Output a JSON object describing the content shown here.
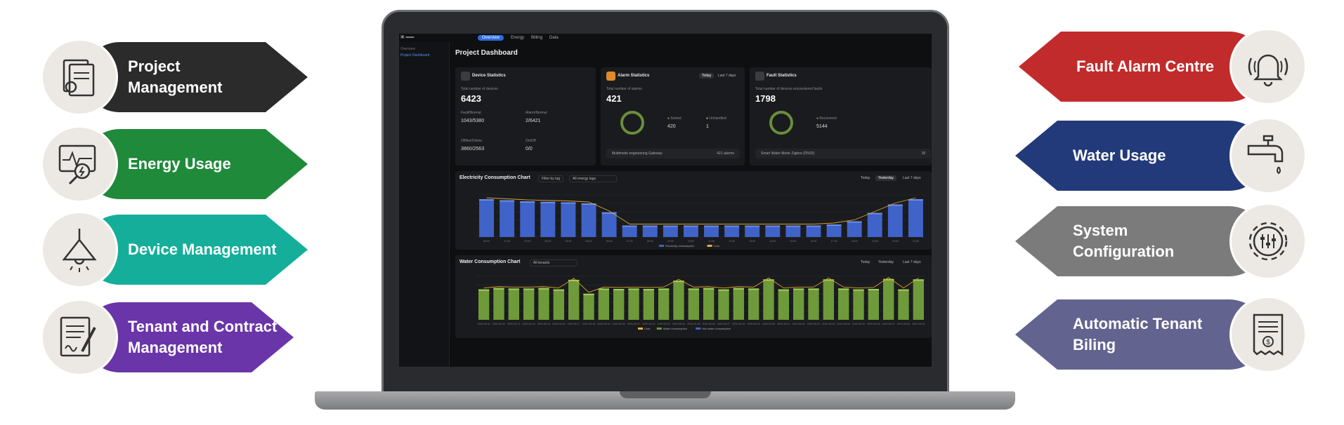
{
  "left_features": [
    {
      "label": "Project\nManagement",
      "icon": "document-icon",
      "color": "#2b2b2b"
    },
    {
      "label": "Energy Usage",
      "icon": "energy-monitor-icon",
      "color": "#1f8a3a"
    },
    {
      "label": "Device Management",
      "icon": "lamp-icon",
      "color": "#15ae9a"
    },
    {
      "label": "Tenant and Contract\nManagement",
      "icon": "contract-icon",
      "color": "#6a35a8"
    }
  ],
  "right_features": [
    {
      "label": "Fault Alarm Centre",
      "icon": "alarm-bell-icon",
      "color": "#c22b2b"
    },
    {
      "label": "Water Usage",
      "icon": "water-tap-icon",
      "color": "#233a7a"
    },
    {
      "label": "System\nConfiguration",
      "icon": "gear-sliders-icon",
      "color": "#7b7b7b"
    },
    {
      "label": "Automatic Tenant\nBiling",
      "icon": "invoice-icon",
      "color": "#63638f"
    }
  ],
  "dashboard": {
    "nav": {
      "tabs": [
        "Overview",
        "Energy",
        "Billing",
        "Data"
      ],
      "active": "Overview"
    },
    "sidebar": {
      "overview": "Overview",
      "project_dashboard": "Project Dashboard"
    },
    "page_title": "Project Dashboard",
    "device_stats": {
      "title": "Device Statistics",
      "total_label": "Total number of devices",
      "total": "6423",
      "fault_label": "Fault/Normal",
      "fault": "1043/5380",
      "alarm_label": "Alarm/Normal",
      "alarm": "2/6421",
      "offline_label": "Offline/Online",
      "offline": "3860/2563",
      "onoff_label": "On/Off",
      "onoff": "0/0"
    },
    "alarm_stats": {
      "title": "Alarm Statistics",
      "tabs": [
        "Today",
        "Last 7 days"
      ],
      "total_label": "Total number of alarms",
      "total": "421",
      "solved_label": "Solved",
      "solved": "420",
      "unhandled_label": "Unhandled",
      "unhandled": "1",
      "footer_name": "Multimode engineering Gateway",
      "footer_value": "421 alarms"
    },
    "fault_stats": {
      "title": "Fault Statistics",
      "total_label": "Total number of devices encountered faults",
      "total": "1798",
      "recovered_label": "Recovered",
      "recovered": "5144",
      "footer_name": "Smart Water Meter Zigbee (DN15)",
      "footer_value": "18"
    },
    "electricity_chart": {
      "title": "Electricity Consumption Chart",
      "filter_tag": "Filter by tag",
      "filter_all": "All energy tags",
      "ranges": [
        "Today",
        "Yesterday",
        "Last 7 days"
      ],
      "active_range": "Yesterday",
      "legend": [
        "Electricity consumption",
        "Cost"
      ]
    },
    "water_chart": {
      "title": "Water Consumption Chart",
      "filter_all": "All tenants",
      "ranges": [
        "Today",
        "Yesterday",
        "Last 7 days"
      ],
      "legend": [
        "Cost",
        "Water consumption",
        "Hot water consumption"
      ]
    }
  },
  "chart_data": [
    {
      "type": "bar",
      "title": "Electricity Consumption Chart",
      "categories": [
        "00:00",
        "01:00",
        "02:00",
        "03:00",
        "04:00",
        "05:00",
        "06:00",
        "07:00",
        "08:00",
        "09:00",
        "10:00",
        "11:00",
        "12:00",
        "13:00",
        "14:00",
        "15:00",
        "16:00",
        "17:00",
        "18:00",
        "19:00",
        "20:00",
        "21:00"
      ],
      "series": [
        {
          "name": "Electricity consumption",
          "values": [
            360,
            350,
            340,
            335,
            330,
            320,
            235,
            110,
            110,
            110,
            110,
            110,
            110,
            110,
            110,
            110,
            110,
            120,
            150,
            230,
            310,
            360
          ]
        }
      ],
      "ylim": [
        0,
        400
      ]
    },
    {
      "type": "bar",
      "title": "Water Consumption Chart",
      "categories": [
        "2020-05-11",
        "2020-05-12",
        "2020-05-13",
        "2020-05-14",
        "2020-05-15",
        "2020-05-16",
        "2020-05-17",
        "2020-05-18",
        "2020-05-19",
        "2020-05-20",
        "2020-05-21",
        "2020-05-22",
        "2020-05-23",
        "2020-05-24",
        "2020-05-25",
        "2020-05-26",
        "2020-05-27",
        "2020-05-28",
        "2020-05-29",
        "2020-05-30",
        "2020-05-31",
        "2020-06-01",
        "2020-06-02",
        "2020-06-03",
        "2020-06-04",
        "2020-06-05",
        "2020-06-06",
        "2020-06-07",
        "2020-06-08",
        "2020-06-09"
      ],
      "series": [
        {
          "name": "Water consumption",
          "values": [
            700,
            730,
            720,
            720,
            730,
            700,
            920,
            600,
            720,
            710,
            720,
            710,
            720,
            900,
            720,
            730,
            700,
            730,
            720,
            930,
            700,
            720,
            720,
            930,
            720,
            700,
            710,
            940,
            700,
            930
          ]
        }
      ],
      "ylim": [
        0,
        1000
      ]
    }
  ]
}
